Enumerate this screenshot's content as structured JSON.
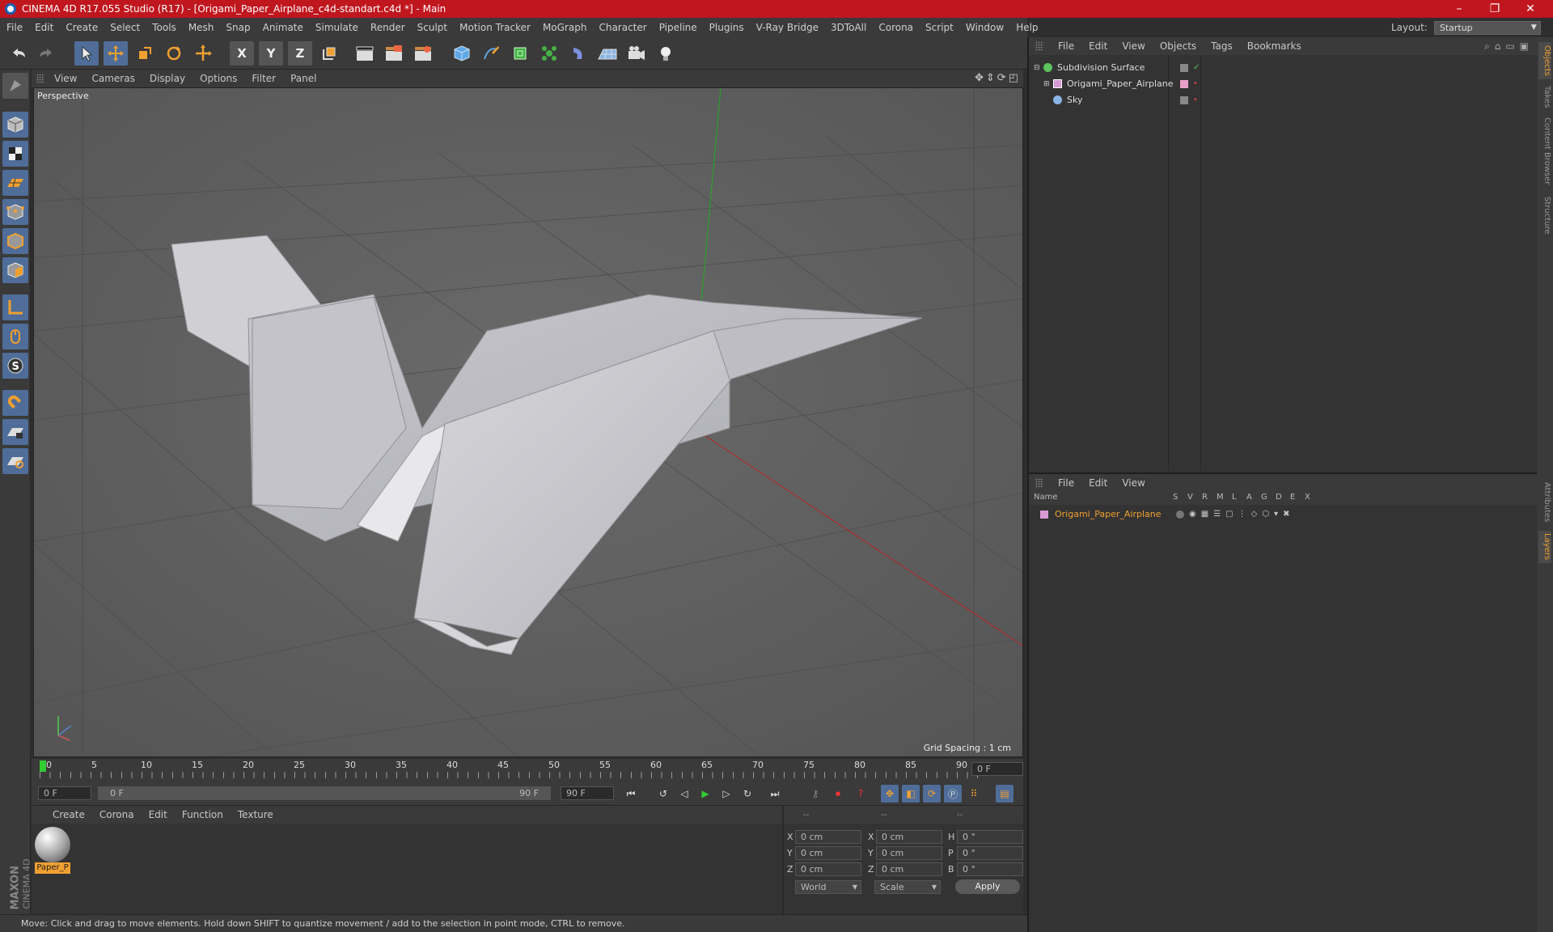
{
  "window": {
    "title": "CINEMA 4D R17.055 Studio (R17) - [Origami_Paper_Airplane_c4d-standart.c4d *] - Main",
    "minimize": "–",
    "maximize": "❐",
    "close": "✕"
  },
  "menu": [
    "File",
    "Edit",
    "Create",
    "Select",
    "Tools",
    "Mesh",
    "Snap",
    "Animate",
    "Simulate",
    "Render",
    "Sculpt",
    "Motion Tracker",
    "MoGraph",
    "Character",
    "Pipeline",
    "Plugins",
    "V-Ray Bridge",
    "3DToAll",
    "Corona",
    "Script",
    "Window",
    "Help"
  ],
  "layout": {
    "label": "Layout:",
    "value": "Startup"
  },
  "toolbar": {
    "axis_x": "X",
    "axis_y": "Y",
    "axis_z": "Z"
  },
  "viewport": {
    "menu": [
      "View",
      "Cameras",
      "Display",
      "Options",
      "Filter",
      "Panel"
    ],
    "label": "Perspective",
    "grid_spacing": "Grid Spacing : 1 cm"
  },
  "timeline": {
    "ticks": [
      "0",
      "5",
      "10",
      "15",
      "20",
      "25",
      "30",
      "35",
      "40",
      "45",
      "50",
      "55",
      "60",
      "65",
      "70",
      "75",
      "80",
      "85",
      "90"
    ],
    "current": "0 F",
    "start": "0 F",
    "range_start": "0 F",
    "range_end": "90 F",
    "end": "90 F"
  },
  "material": {
    "menu": [
      "Create",
      "Corona",
      "Edit",
      "Function",
      "Texture"
    ],
    "items": [
      {
        "name": "Paper_P"
      }
    ]
  },
  "coords": {
    "headers": [
      "--",
      "--",
      "--"
    ],
    "rows": [
      {
        "a": "X",
        "av": "0 cm",
        "b": "X",
        "bv": "0 cm",
        "c": "H",
        "cv": "0 °"
      },
      {
        "a": "Y",
        "av": "0 cm",
        "b": "Y",
        "bv": "0 cm",
        "c": "P",
        "cv": "0 °"
      },
      {
        "a": "Z",
        "av": "0 cm",
        "b": "Z",
        "bv": "0 cm",
        "c": "B",
        "cv": "0 °"
      }
    ],
    "mode": "World",
    "scale": "Scale",
    "apply": "Apply"
  },
  "status": "Move: Click and drag to move elements. Hold down SHIFT to quantize movement / add to the selection in point mode, CTRL to remove.",
  "objects": {
    "menu": [
      "File",
      "Edit",
      "View",
      "Objects",
      "Tags",
      "Bookmarks"
    ],
    "items": [
      {
        "name": "Subdivision Surface",
        "color": "#5dc35d"
      },
      {
        "name": "Origami_Paper_Airplane",
        "color": "#d79ad2"
      },
      {
        "name": "Sky",
        "color": "#8ab4e6"
      }
    ]
  },
  "layers": {
    "menu": [
      "File",
      "Edit",
      "View"
    ],
    "headers": [
      "Name",
      "S",
      "V",
      "R",
      "M",
      "L",
      "A",
      "G",
      "D",
      "E",
      "X"
    ],
    "items": [
      {
        "name": "Origami_Paper_Airplane",
        "color": "#f0a030"
      }
    ]
  },
  "sidetabs": [
    "Objects",
    "Takes",
    "Content Browser",
    "Structure",
    "Attributes",
    "Layers"
  ],
  "branding": {
    "line1": "MAXON",
    "line2": "CINEMA 4D"
  }
}
